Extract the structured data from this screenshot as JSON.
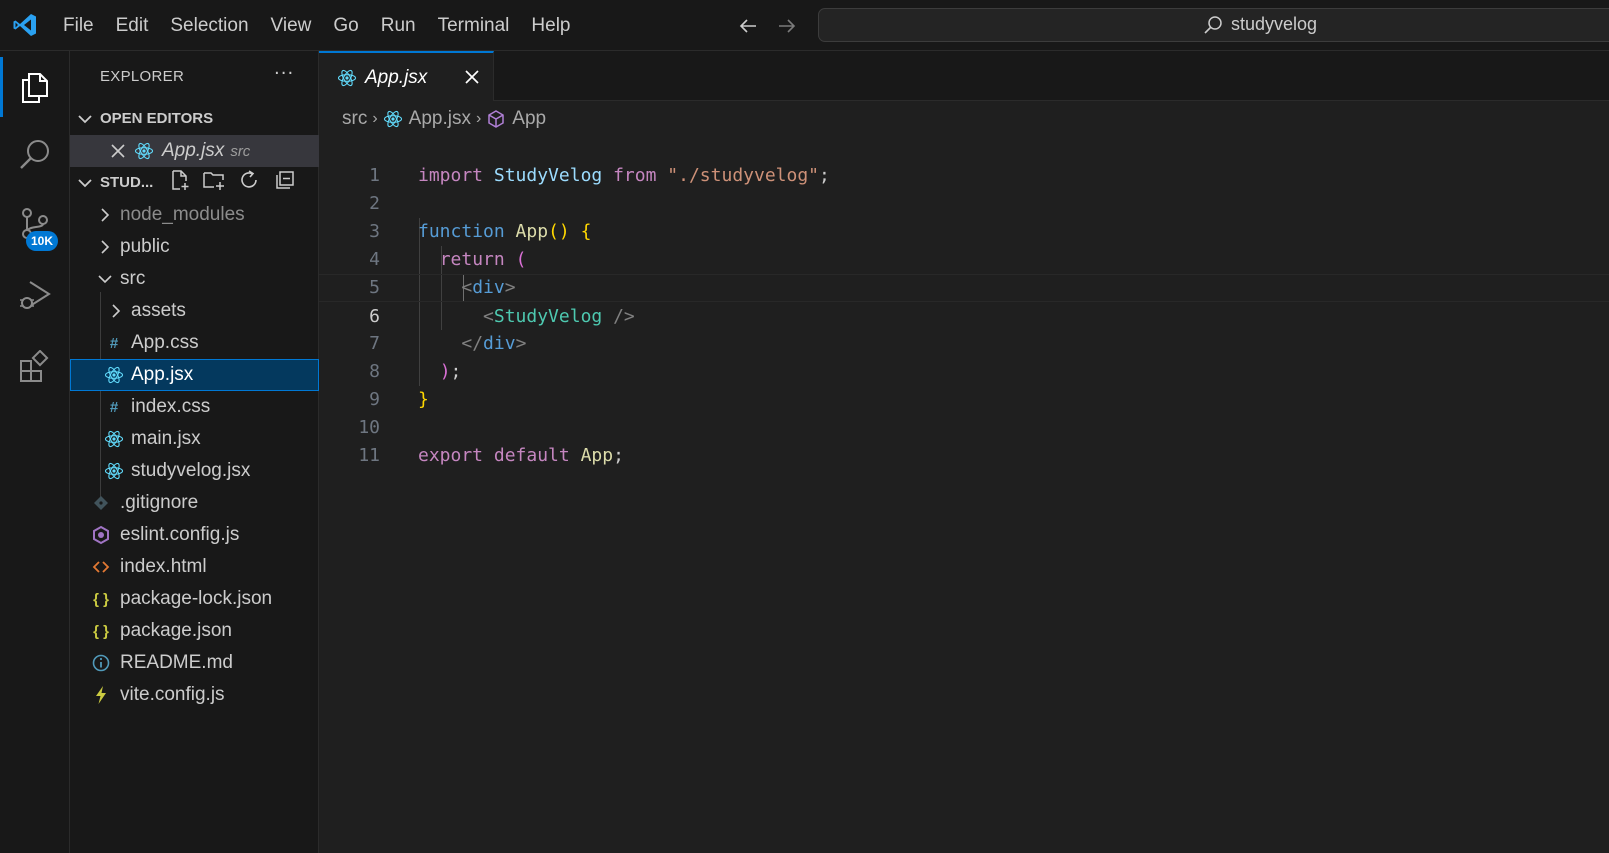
{
  "titlebar": {
    "menu": [
      "File",
      "Edit",
      "Selection",
      "View",
      "Go",
      "Run",
      "Terminal",
      "Help"
    ],
    "search_text": "studyvelog"
  },
  "activity": {
    "scm_badge": "10K"
  },
  "sidebar": {
    "header": "EXPLORER",
    "more": "···",
    "open_editors_title": "OPEN EDITORS",
    "open_editor": {
      "name": "App.jsx",
      "hint": "src"
    },
    "project_title": "STUD...",
    "tree": [
      {
        "name": "node_modules",
        "type": "folder",
        "expanded": false,
        "depth": 0,
        "dim": true
      },
      {
        "name": "public",
        "type": "folder",
        "expanded": false,
        "depth": 0
      },
      {
        "name": "src",
        "type": "folder",
        "expanded": true,
        "depth": 0
      },
      {
        "name": "assets",
        "type": "folder",
        "expanded": false,
        "depth": 1
      },
      {
        "name": "App.css",
        "type": "css",
        "depth": 1
      },
      {
        "name": "App.jsx",
        "type": "react",
        "depth": 1,
        "selected": true
      },
      {
        "name": "index.css",
        "type": "css",
        "depth": 1
      },
      {
        "name": "main.jsx",
        "type": "react",
        "depth": 1
      },
      {
        "name": "studyvelog.jsx",
        "type": "react",
        "depth": 1
      },
      {
        "name": ".gitignore",
        "type": "git",
        "depth": 0
      },
      {
        "name": "eslint.config.js",
        "type": "eslint",
        "depth": 0
      },
      {
        "name": "index.html",
        "type": "html",
        "depth": 0
      },
      {
        "name": "package-lock.json",
        "type": "json",
        "depth": 0
      },
      {
        "name": "package.json",
        "type": "json",
        "depth": 0
      },
      {
        "name": "README.md",
        "type": "info",
        "depth": 0
      },
      {
        "name": "vite.config.js",
        "type": "vite",
        "depth": 0
      }
    ]
  },
  "editor": {
    "tab_label": "App.jsx",
    "breadcrumb": [
      "src",
      "App.jsx",
      "App"
    ],
    "active_line": 6,
    "lines": [
      "import StudyVelog from \"./studyvelog\";",
      "",
      "function App() {",
      "  return (",
      "    <div>",
      "      <StudyVelog />",
      "    </div>",
      "  );",
      "}",
      "",
      "export default App;"
    ]
  },
  "colors": {
    "accent": "#0078d4",
    "keyword": "#c586c0",
    "function": "#dcdcaa",
    "component": "#4ec9b0",
    "string": "#ce9178"
  }
}
